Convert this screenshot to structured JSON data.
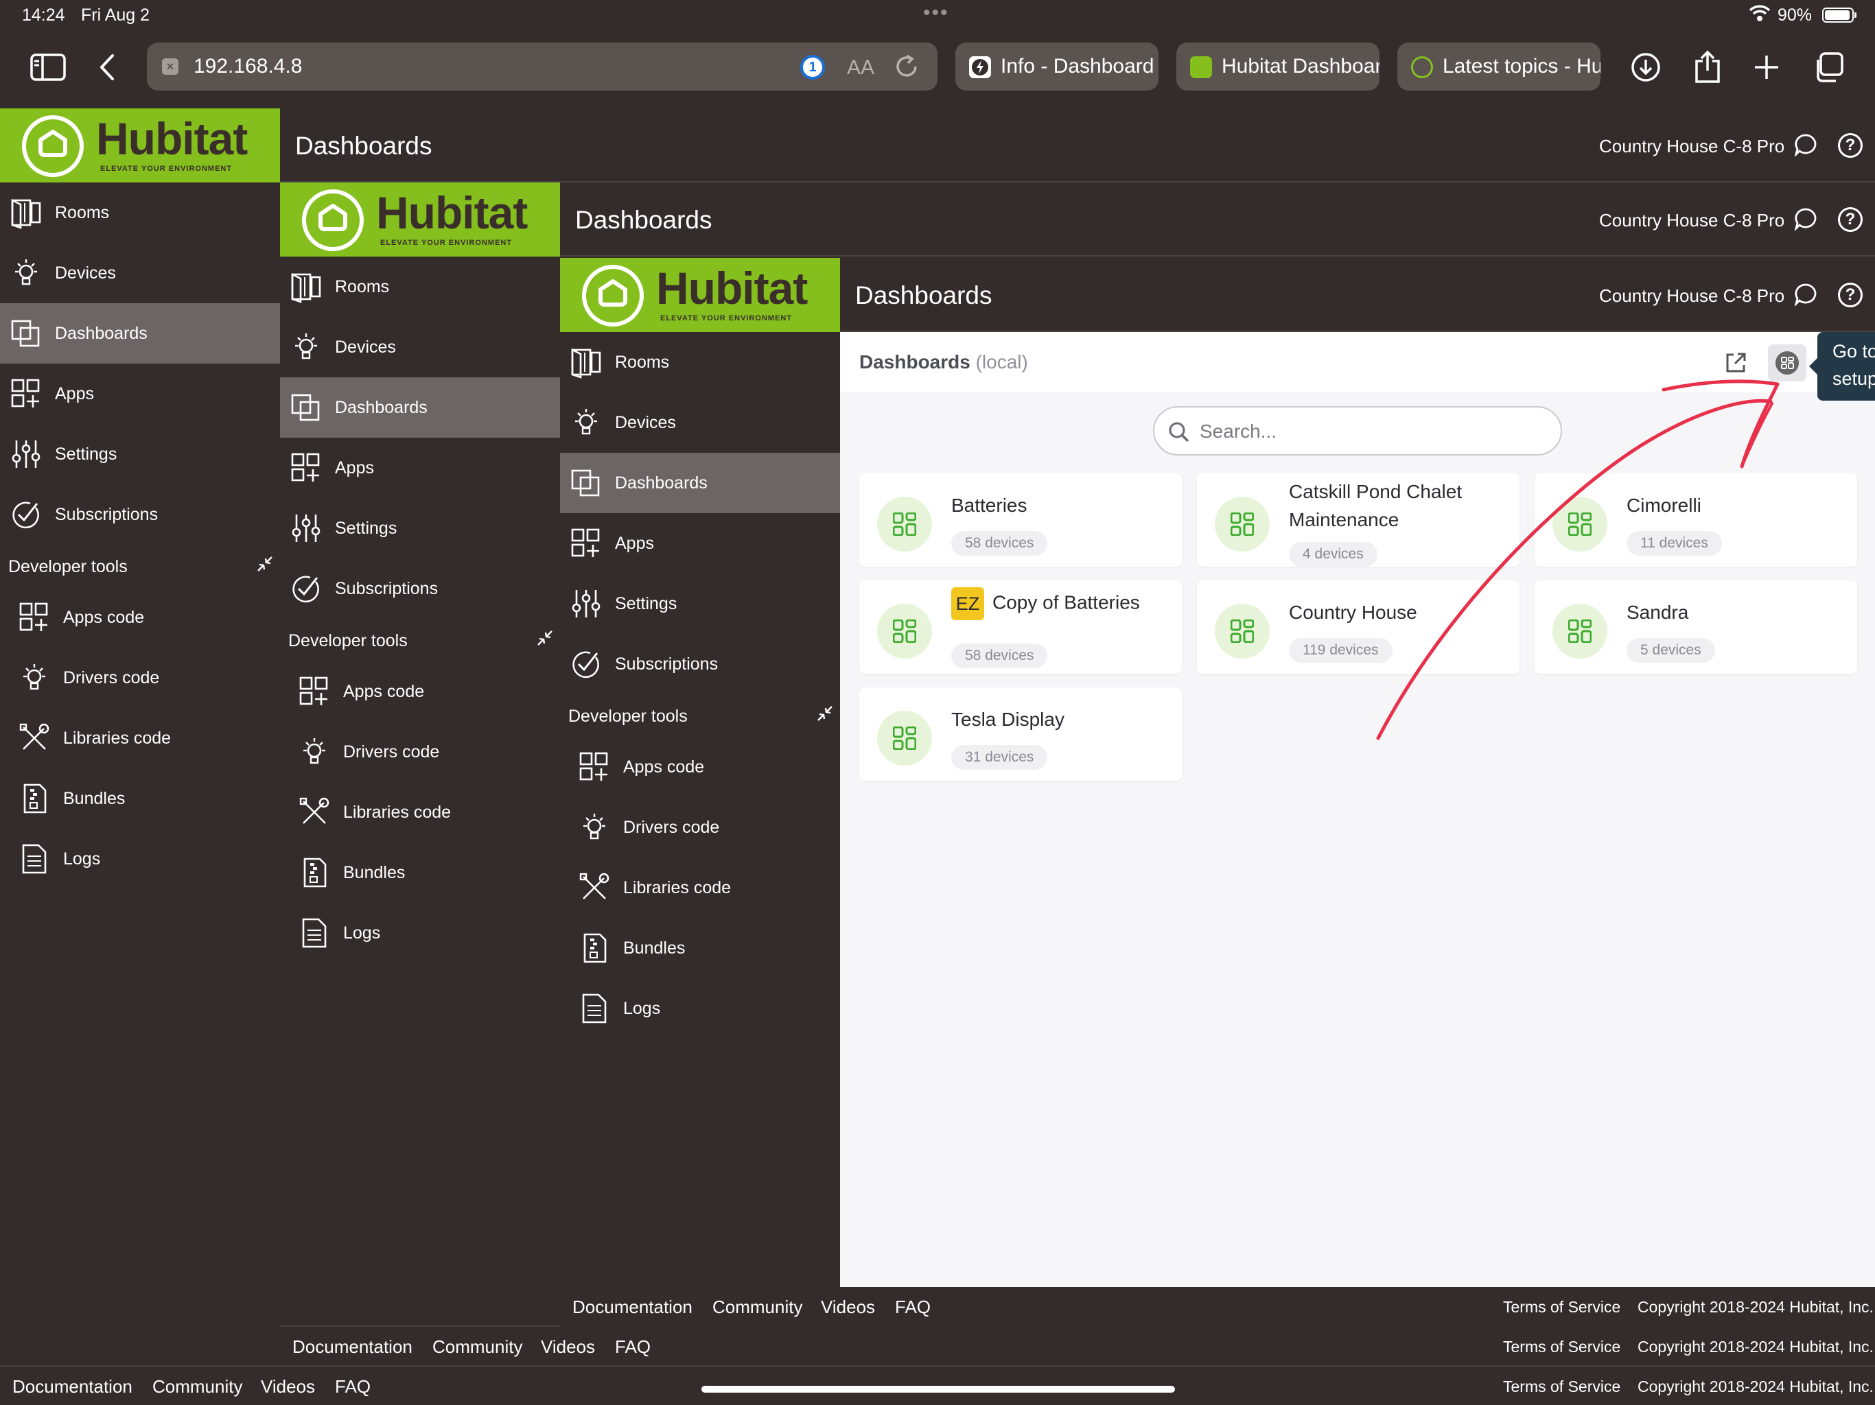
{
  "status_bar": {
    "time": "14:24",
    "date": "Fri Aug 2",
    "battery": "90%"
  },
  "browser": {
    "url": "192.168.4.8",
    "text_size": "AA",
    "tabs": [
      {
        "title": "Info - Dashboard"
      },
      {
        "title": "Hubitat Dashboard"
      },
      {
        "title": "Latest topics - Hubitat"
      }
    ]
  },
  "app": {
    "logo_word": "Hubitat",
    "logo_tagline": "ELEVATE YOUR ENVIRONMENT",
    "header_title": "Dashboards",
    "hub_name": "Country House C-8 Pro",
    "nav": {
      "rooms": "Rooms",
      "devices": "Devices",
      "dashboards": "Dashboards",
      "apps": "Apps",
      "settings": "Settings",
      "subscriptions": "Subscriptions"
    },
    "developer_tools": {
      "heading": "Developer tools",
      "apps_code": "Apps code",
      "drivers_code": "Drivers code",
      "libraries_code": "Libraries code",
      "bundles": "Bundles",
      "logs": "Logs"
    },
    "footer": {
      "documentation": "Documentation",
      "community": "Community",
      "videos": "Videos",
      "faq": "FAQ",
      "terms": "Terms of Service",
      "copyright": "Copyright 2018-2024 Hubitat, Inc."
    }
  },
  "content": {
    "title": "Dashboards",
    "title_suffix": "(local)",
    "tooltip_line1": "Go to",
    "tooltip_line2": "setup",
    "search_placeholder": "Search...",
    "dashboards": [
      {
        "name": "Batteries",
        "count": "58 devices"
      },
      {
        "name": "Catskill Pond Chalet Maintenance",
        "count": "4 devices"
      },
      {
        "name": "Cimorelli",
        "count": "11 devices"
      },
      {
        "name": "Copy of Batteries",
        "badge": "EZ",
        "count": "58 devices"
      },
      {
        "name": "Country House",
        "count": "119 devices"
      },
      {
        "name": "Sandra",
        "count": "5 devices"
      },
      {
        "name": "Tesla Display",
        "count": "31 devices"
      }
    ]
  },
  "colors": {
    "brand_green": "#84bf1d",
    "header_bg": "#342c2a",
    "active_nav": "#6d6563",
    "annotation_red": "#e8304a"
  }
}
